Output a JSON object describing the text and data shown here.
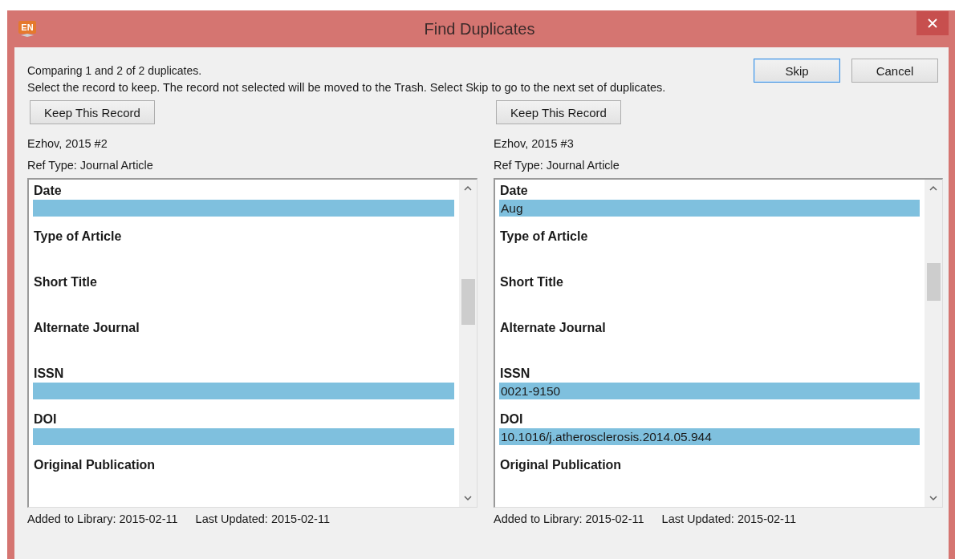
{
  "window": {
    "logo": "EN",
    "title": "Find Duplicates"
  },
  "status": "Comparing 1 and 2 of 2 duplicates.",
  "instructions": "Select the record to keep. The record not selected will be moved to the Trash. Select Skip to go to the next set of duplicates.",
  "buttons": [
    {
      "label": "Skip",
      "focused": true
    },
    {
      "label": "Cancel",
      "focused": false
    }
  ],
  "records": [
    {
      "keep_button": "Keep This Record",
      "name": "Ezhov, 2015 #2",
      "ref_type": "Ref Type: Journal Article",
      "fields": [
        {
          "label": "Date",
          "highlighted": true
        },
        {
          "label": "Type of Article",
          "highlighted": false
        },
        {
          "label": "Short Title",
          "highlighted": false
        },
        {
          "label": "Alternate Journal",
          "highlighted": false
        },
        {
          "label": "ISSN",
          "highlighted": true
        },
        {
          "label": "DOI",
          "highlighted": true
        },
        {
          "label": "Original Publication",
          "highlighted": false
        }
      ],
      "added": "Added to Library: 2015-02-11",
      "updated": "Last Updated: 2015-02-11"
    },
    {
      "keep_button": "Keep This Record",
      "name": "Ezhov, 2015 #3",
      "ref_type": "Ref Type: Journal Article",
      "fields": [
        {
          "label": "Date",
          "value": "Aug",
          "highlighted": true
        },
        {
          "label": "Type of Article",
          "highlighted": false
        },
        {
          "label": "Short Title",
          "highlighted": false
        },
        {
          "label": "Alternate Journal",
          "highlighted": false
        },
        {
          "label": "ISSN",
          "value": "0021-9150",
          "highlighted": true
        },
        {
          "label": "DOI",
          "value": "10.1016/j.atherosclerosis.2014.05.944",
          "highlighted": true
        },
        {
          "label": "Original Publication",
          "highlighted": false
        }
      ],
      "added": "Added to Library: 2015-02-11",
      "updated": "Last Updated: 2015-02-11"
    }
  ]
}
